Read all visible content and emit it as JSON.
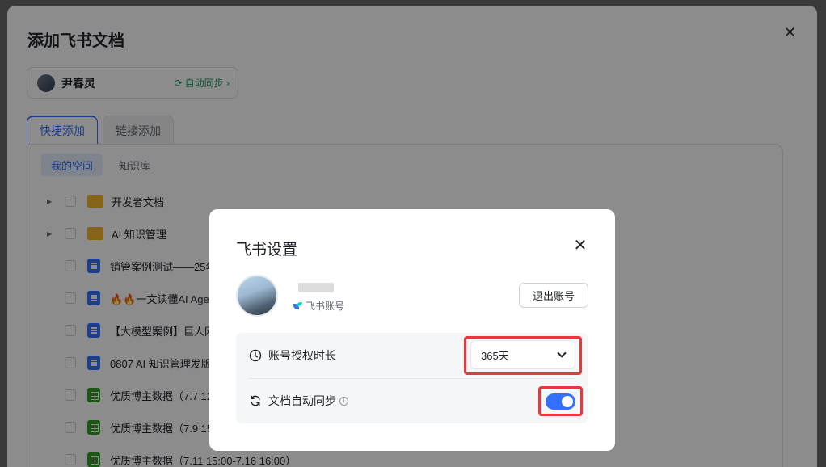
{
  "background": {
    "title": "添加飞书文档",
    "account": {
      "name": "尹春灵",
      "sync_label": "自动同步 ›"
    },
    "tabs": [
      {
        "label": "快捷添加",
        "active": true
      },
      {
        "label": "链接添加",
        "active": false
      }
    ],
    "subtabs": [
      {
        "label": "我的空间",
        "active": true
      },
      {
        "label": "知识库",
        "active": false
      }
    ],
    "files": [
      {
        "name": "开发者文档",
        "type": "folder",
        "expandable": true
      },
      {
        "name": "AI 知识管理",
        "type": "folder",
        "expandable": true
      },
      {
        "name": "销管案例测试——25年",
        "type": "doc",
        "expandable": false
      },
      {
        "name": "🔥🔥一文读懂AI Age",
        "type": "doc",
        "expandable": false
      },
      {
        "name": "【大模型案例】巨人网",
        "type": "doc",
        "expandable": false
      },
      {
        "name": "0807 AI 知识管理发版",
        "type": "doc",
        "expandable": false
      },
      {
        "name": "优质博主数据（7.7 12",
        "type": "sheet",
        "expandable": false
      },
      {
        "name": "优质博主数据（7.9 15",
        "type": "sheet",
        "expandable": false
      },
      {
        "name": "优质博主数据（7.11 15:00-7.16 16:00）",
        "type": "sheet",
        "expandable": false
      }
    ]
  },
  "modal": {
    "title": "飞书设置",
    "close_glyph": "✕",
    "user_source": "飞书账号",
    "logout_label": "退出账号",
    "settings": {
      "auth_duration_label": "账号授权时长",
      "auth_duration_value": "365天",
      "auto_sync_label": "文档自动同步",
      "auto_sync_enabled": true
    }
  },
  "colors": {
    "accent": "#3370ff",
    "highlight": "#e5393b",
    "sync_green": "#1a9a5e"
  }
}
